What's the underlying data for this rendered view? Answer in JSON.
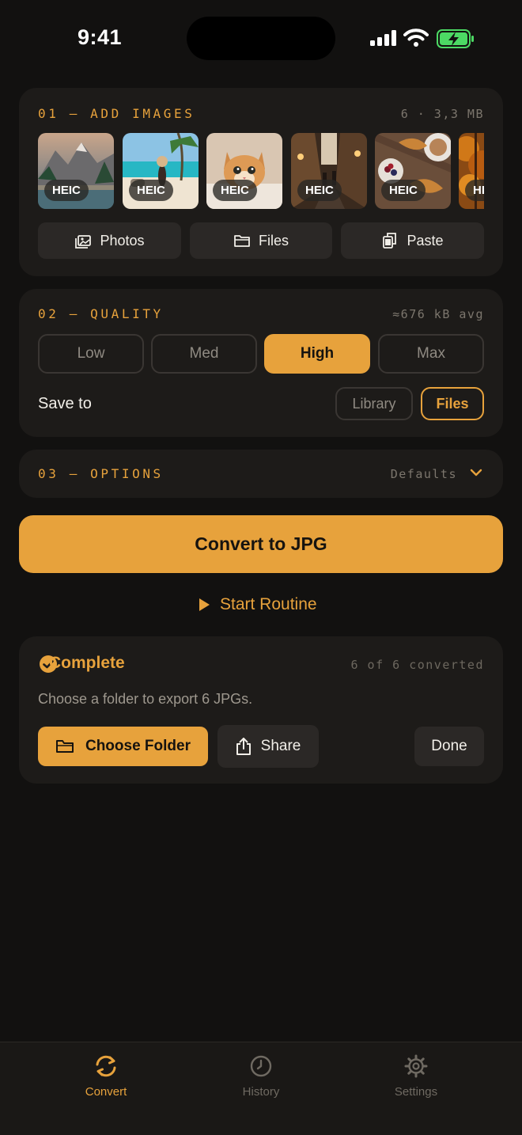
{
  "status_bar": {
    "time": "9:41"
  },
  "add_images": {
    "title": "01 — ADD IMAGES",
    "meta": "6 · 3,3 MB",
    "thumbnails": [
      {
        "badge": "HEIC",
        "subject": "mountain-lake"
      },
      {
        "badge": "HEIC",
        "subject": "beach"
      },
      {
        "badge": "HEIC",
        "subject": "kitten"
      },
      {
        "badge": "HEIC",
        "subject": "city-street"
      },
      {
        "badge": "HEIC",
        "subject": "breakfast"
      },
      {
        "badge": "HEIC",
        "subject": "autumn-trees"
      }
    ],
    "buttons": {
      "photos": "Photos",
      "files": "Files",
      "paste": "Paste"
    }
  },
  "quality": {
    "title": "02 — QUALITY",
    "meta": "≈676 kB avg",
    "levels": [
      "Low",
      "Med",
      "High",
      "Max"
    ],
    "selected": "High",
    "save_to_label": "Save to",
    "destinations": [
      "Library",
      "Files"
    ],
    "selected_destination": "Files"
  },
  "options": {
    "title": "03 — OPTIONS",
    "meta": "Defaults"
  },
  "convert_label": "Convert to JPG",
  "routine_label": "Start Routine",
  "complete": {
    "title": "Complete",
    "meta": "6 of 6 converted",
    "message": "Choose a folder to export 6 JPGs.",
    "choose_folder": "Choose Folder",
    "share": "Share",
    "done": "Done"
  },
  "tabs": [
    {
      "label": "Convert",
      "active": true
    },
    {
      "label": "History",
      "active": false
    },
    {
      "label": "Settings",
      "active": false
    }
  ],
  "colors": {
    "accent": "#e7a23c",
    "background": "#121110",
    "card": "#1d1b19",
    "button": "#2b2826",
    "battery": "#4cd964"
  }
}
